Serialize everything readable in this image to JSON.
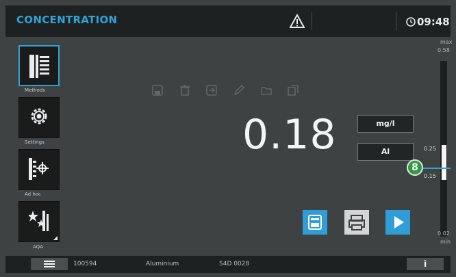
{
  "header": {
    "title": "CONCENTRATION",
    "warning_icon": "warning-triangle-icon",
    "clock_icon": "clock-icon",
    "time": "09:48"
  },
  "nav": [
    {
      "label": "Methods",
      "icon": "methods-list-icon",
      "active": true
    },
    {
      "label": "Settings",
      "icon": "gear-icon",
      "active": false
    },
    {
      "label": "Ad hoc",
      "icon": "ad-hoc-target-icon",
      "active": false
    },
    {
      "label": "AQA",
      "icon": "aqa-stars-icon",
      "active": false
    }
  ],
  "toolbar_faint_icons": [
    "save-icon",
    "delete-icon",
    "export-icon",
    "edit-icon",
    "folder-icon",
    "copy-icon"
  ],
  "reading": {
    "value": "0.18",
    "unit": "mg/l",
    "species": "Al"
  },
  "range": {
    "max_label": "max",
    "max_value": "0.58",
    "window_upper": "0.25",
    "window_lower": "0.15",
    "min_value": "0.02",
    "min_label": "min",
    "badge": "8"
  },
  "actions": [
    {
      "name": "save-button",
      "icon": "save-icon"
    },
    {
      "name": "print-button",
      "icon": "print-icon"
    },
    {
      "name": "start-button",
      "icon": "play-icon"
    }
  ],
  "status": {
    "menu_icon": "hamburger-menu-icon",
    "method_number": "100594",
    "method_name": "Aluminium",
    "serial": "S4D 0028",
    "info_label": "i"
  },
  "colors": {
    "accent": "#2fa3d6",
    "badge": "#2f9a43",
    "background": "#3f4242",
    "bar": "#1e2121"
  }
}
